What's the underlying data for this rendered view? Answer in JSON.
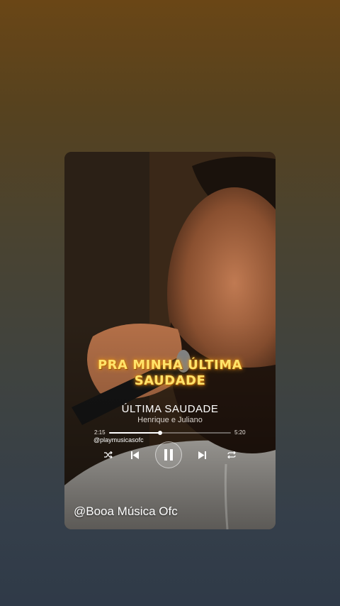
{
  "lyrics": {
    "line1": "PRA MINHA ÚLTIMA",
    "line2": "SAUDADE"
  },
  "player": {
    "title": "ÚLTIMA SAUDADE",
    "artist": "Henrique e Juliano",
    "current_time": "2:15",
    "total_time": "5:20",
    "progress": 0.42,
    "handle": "@playmusicasofc"
  },
  "icons": {
    "shuffle": "shuffle-icon",
    "previous": "previous-icon",
    "pause": "pause-icon",
    "next": "next-icon",
    "repeat": "repeat-icon"
  },
  "watermark": "@Booa Música Ofc",
  "colors": {
    "lyrics": "#ffe36a",
    "text": "#ffffff"
  }
}
